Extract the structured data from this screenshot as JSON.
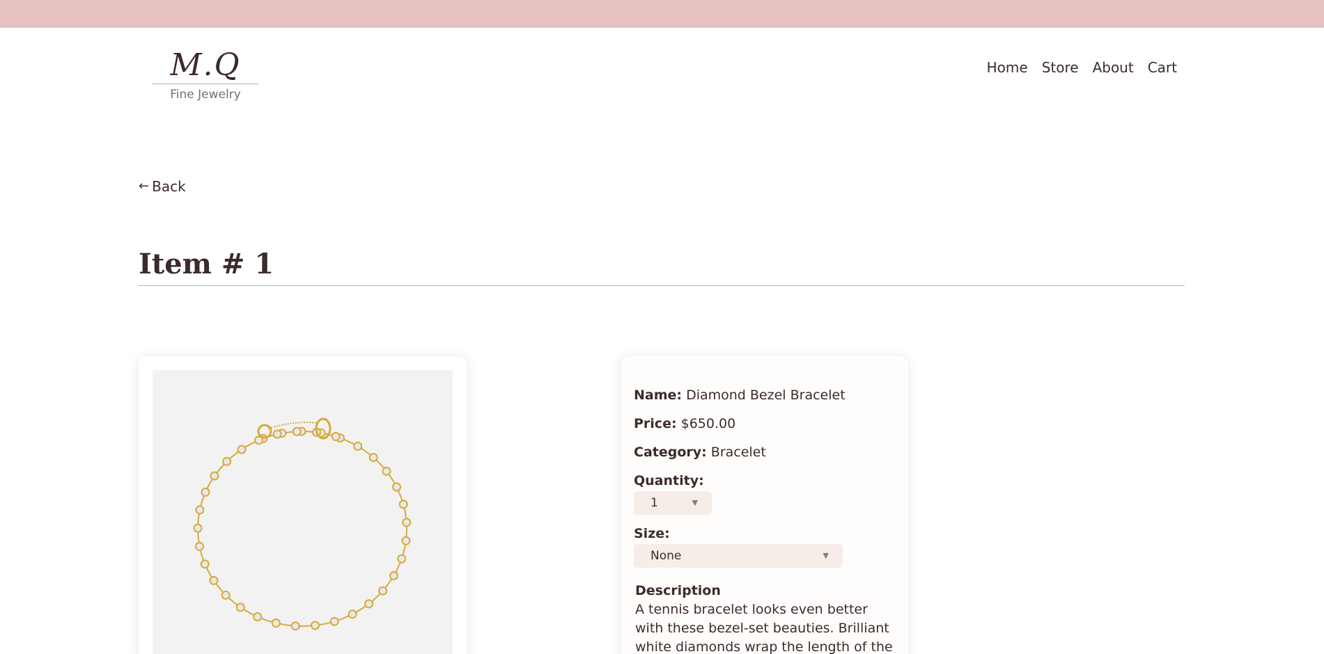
{
  "header": {
    "logo_mark": "M.Q",
    "logo_subtitle": "Fine Jewelry",
    "nav": [
      {
        "label": "Home"
      },
      {
        "label": "Store"
      },
      {
        "label": "About"
      },
      {
        "label": "Cart"
      }
    ]
  },
  "back": {
    "arrow": "←",
    "label": "Back"
  },
  "page_title": "Item # 1",
  "product": {
    "image_icon": "bracelet-image",
    "name_label": "Name:",
    "name_value": "Diamond Bezel Bracelet",
    "price_label": "Price:",
    "price_value": "$650.00",
    "category_label": "Category:",
    "category_value": "Bracelet",
    "quantity_label": "Quantity:",
    "quantity_value": "1",
    "size_label": "Size:",
    "size_value": "None",
    "caret": "▼",
    "description_heading": "Description",
    "description_text": "A tennis bracelet looks even better with these bezel-set beauties. Brilliant white diamonds wrap the length of the bracelet"
  },
  "colors": {
    "banner": "#e7c0c1",
    "text": "#3d2b2b",
    "select_bg": "#f6ede8",
    "gold": "#d6aa3a"
  }
}
